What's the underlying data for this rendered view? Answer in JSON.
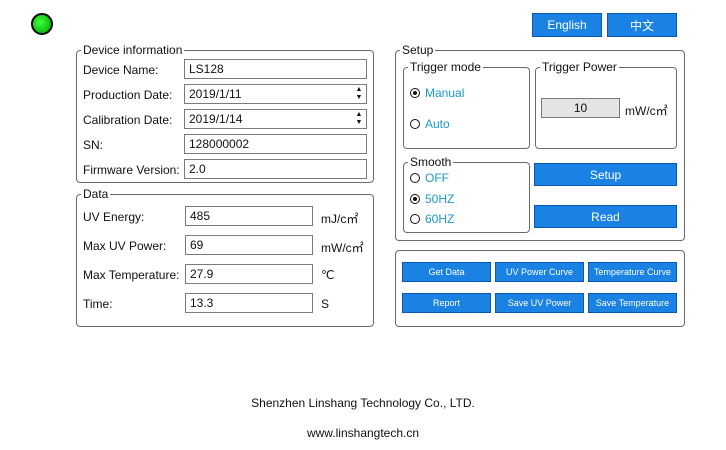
{
  "colors": {
    "accent": "#1a82e2",
    "status_led": "#14c814",
    "radio_text": "#1a9ac9"
  },
  "status": {
    "icon": "status-led-icon",
    "state": "connected"
  },
  "language": {
    "english": "English",
    "chinese": "中文"
  },
  "device_information": {
    "legend": "Device information",
    "name_label": "Device Name:",
    "name_value": "LS128",
    "production_label": "Production Date:",
    "production_value": "2019/1/11",
    "calibration_label": "Calibration Date:",
    "calibration_value": "2019/1/14",
    "sn_label": "SN:",
    "sn_value": "128000002",
    "firmware_label": "Firmware Version:",
    "firmware_value": "2.0"
  },
  "data": {
    "legend": "Data",
    "uv_energy_label": "UV Energy:",
    "uv_energy_value": "485",
    "uv_energy_unit": "mJ/c㎡",
    "max_uv_power_label": "Max UV Power:",
    "max_uv_power_value": "69",
    "max_uv_power_unit": "mW/c㎡",
    "max_temp_label": "Max Temperature:",
    "max_temp_value": "27.9",
    "max_temp_unit": "℃",
    "time_label": "Time:",
    "time_value": "13.3",
    "time_unit": "S"
  },
  "setup": {
    "legend": "Setup",
    "trigger_mode": {
      "legend": "Trigger mode",
      "manual": "Manual",
      "auto": "Auto",
      "selected": "Manual"
    },
    "trigger_power": {
      "legend": "Trigger Power",
      "value": "10",
      "unit": "mW/c㎡"
    },
    "smooth": {
      "legend": "Smooth",
      "off": "OFF",
      "hz50": "50HZ",
      "hz60": "60HZ",
      "selected": "50HZ"
    },
    "setup_button": "Setup",
    "read_button": "Read"
  },
  "actions": {
    "get_data": "Get Data",
    "uv_power_curve": "UV Power Curve",
    "temperature_curve": "Temperature Curve",
    "report": "Report",
    "save_uv_power": "Save UV Power",
    "save_temperature": "Save Temperature"
  },
  "footer": {
    "company": "Shenzhen Linshang Technology Co., LTD.",
    "website": "www.linshangtech.cn"
  }
}
